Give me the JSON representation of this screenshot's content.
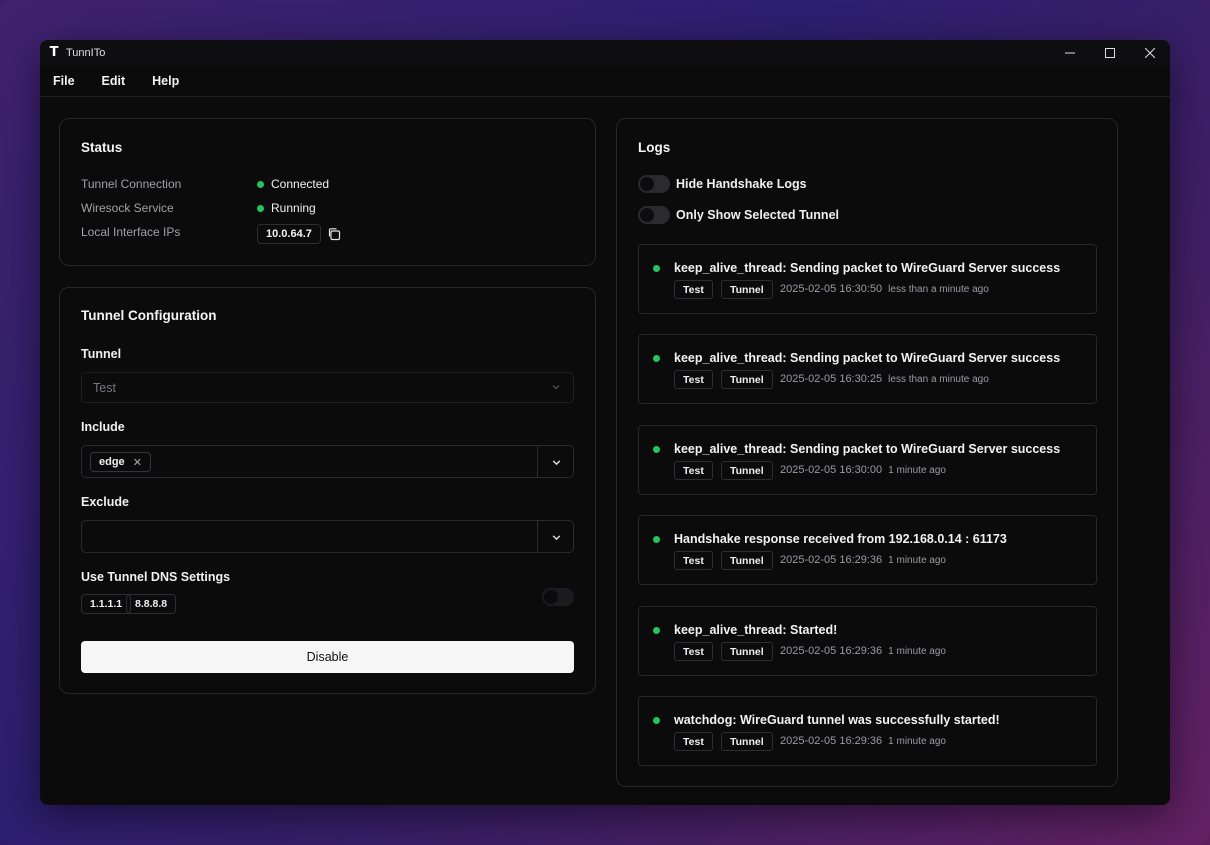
{
  "window": {
    "title": "TunnITo",
    "logo_letter": "T",
    "controls": {
      "minimize": "—",
      "maximize": "☐",
      "close": "✕"
    }
  },
  "menu": [
    "File",
    "Edit",
    "Help"
  ],
  "status": {
    "title": "Status",
    "rows": [
      {
        "label": "Tunnel Connection",
        "value": "Connected",
        "indicator": "#22c55e"
      },
      {
        "label": "Wiresock Service",
        "value": "Running",
        "indicator": "#22c55e"
      }
    ],
    "ip_label": "Local Interface IPs",
    "ip_value": "10.0.64.7"
  },
  "config": {
    "title": "Tunnel Configuration",
    "tunnel_label": "Tunnel",
    "tunnel_value": "Test",
    "include_label": "Include",
    "include_tags": [
      "edge"
    ],
    "exclude_label": "Exclude",
    "dns_label": "Use Tunnel DNS Settings",
    "dns_servers": [
      "1.1.1.1",
      "8.8.8.8"
    ],
    "dns_enabled": false,
    "disable_button": "Disable"
  },
  "logs": {
    "title": "Logs",
    "hide_handshake_label": "Hide Handshake Logs",
    "hide_handshake_enabled": false,
    "only_selected_label": "Only Show Selected Tunnel",
    "only_selected_enabled": false,
    "entries": [
      {
        "message": "keep_alive_thread: Sending packet to WireGuard Server success",
        "tunnel_tag": "Test",
        "type_tag": "Tunnel",
        "timestamp": "2025-02-05  16:30:50",
        "relative": "less than a minute ago"
      },
      {
        "message": "keep_alive_thread: Sending packet to WireGuard Server success",
        "tunnel_tag": "Test",
        "type_tag": "Tunnel",
        "timestamp": "2025-02-05  16:30:25",
        "relative": "less than a minute ago"
      },
      {
        "message": "keep_alive_thread: Sending packet to WireGuard Server success",
        "tunnel_tag": "Test",
        "type_tag": "Tunnel",
        "timestamp": "2025-02-05  16:30:00",
        "relative": "1 minute ago"
      },
      {
        "message": "Handshake response received from 192.168.0.14 : 61173",
        "tunnel_tag": "Test",
        "type_tag": "Tunnel",
        "timestamp": "2025-02-05  16:29:36",
        "relative": "1 minute ago"
      },
      {
        "message": "keep_alive_thread: Started!",
        "tunnel_tag": "Test",
        "type_tag": "Tunnel",
        "timestamp": "2025-02-05  16:29:36",
        "relative": "1 minute ago"
      },
      {
        "message": "watchdog: WireGuard tunnel was successfully started!",
        "tunnel_tag": "Test",
        "type_tag": "Tunnel",
        "timestamp": "2025-02-05  16:29:36",
        "relative": "1 minute ago"
      }
    ]
  },
  "colors": {
    "accent_green": "#22c55e",
    "window_bg": "#0b0b0c",
    "border": "#26262b"
  }
}
